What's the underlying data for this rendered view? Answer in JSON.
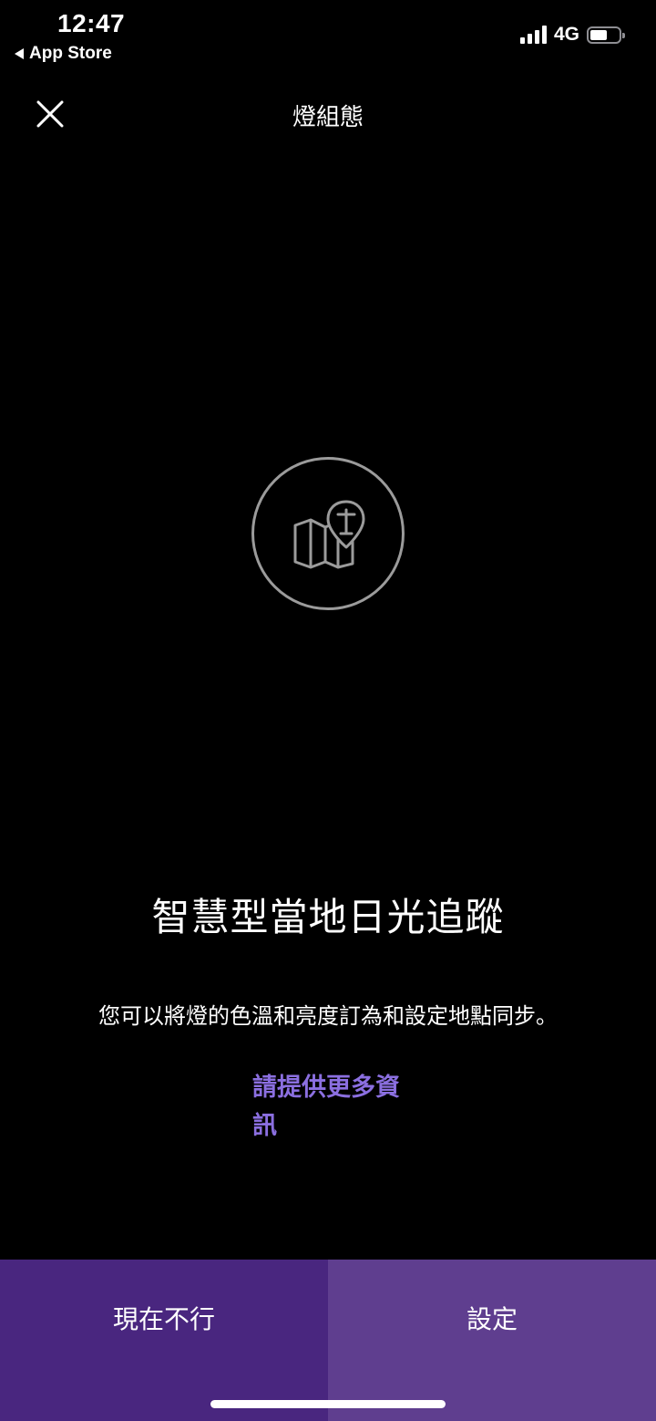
{
  "status_bar": {
    "time": "12:47",
    "back_label": "App Store",
    "network": "4G",
    "battery_level": 0.5
  },
  "header": {
    "title": "燈組態",
    "close_icon": "close-icon"
  },
  "hero": {
    "icon": "map-pin-icon"
  },
  "content": {
    "title": "智慧型當地日光追蹤",
    "description": "您可以將燈的色溫和亮度訂為和設定地點同步。",
    "more_info_line1": "請提供更多資",
    "more_info_line2": "訊"
  },
  "actions": {
    "not_now_label": "現在不行",
    "setup_label": "設定"
  },
  "colors": {
    "background": "#000000",
    "link": "#8b6fe0",
    "button_left": "#49267f",
    "button_right": "#5f3e8f"
  }
}
